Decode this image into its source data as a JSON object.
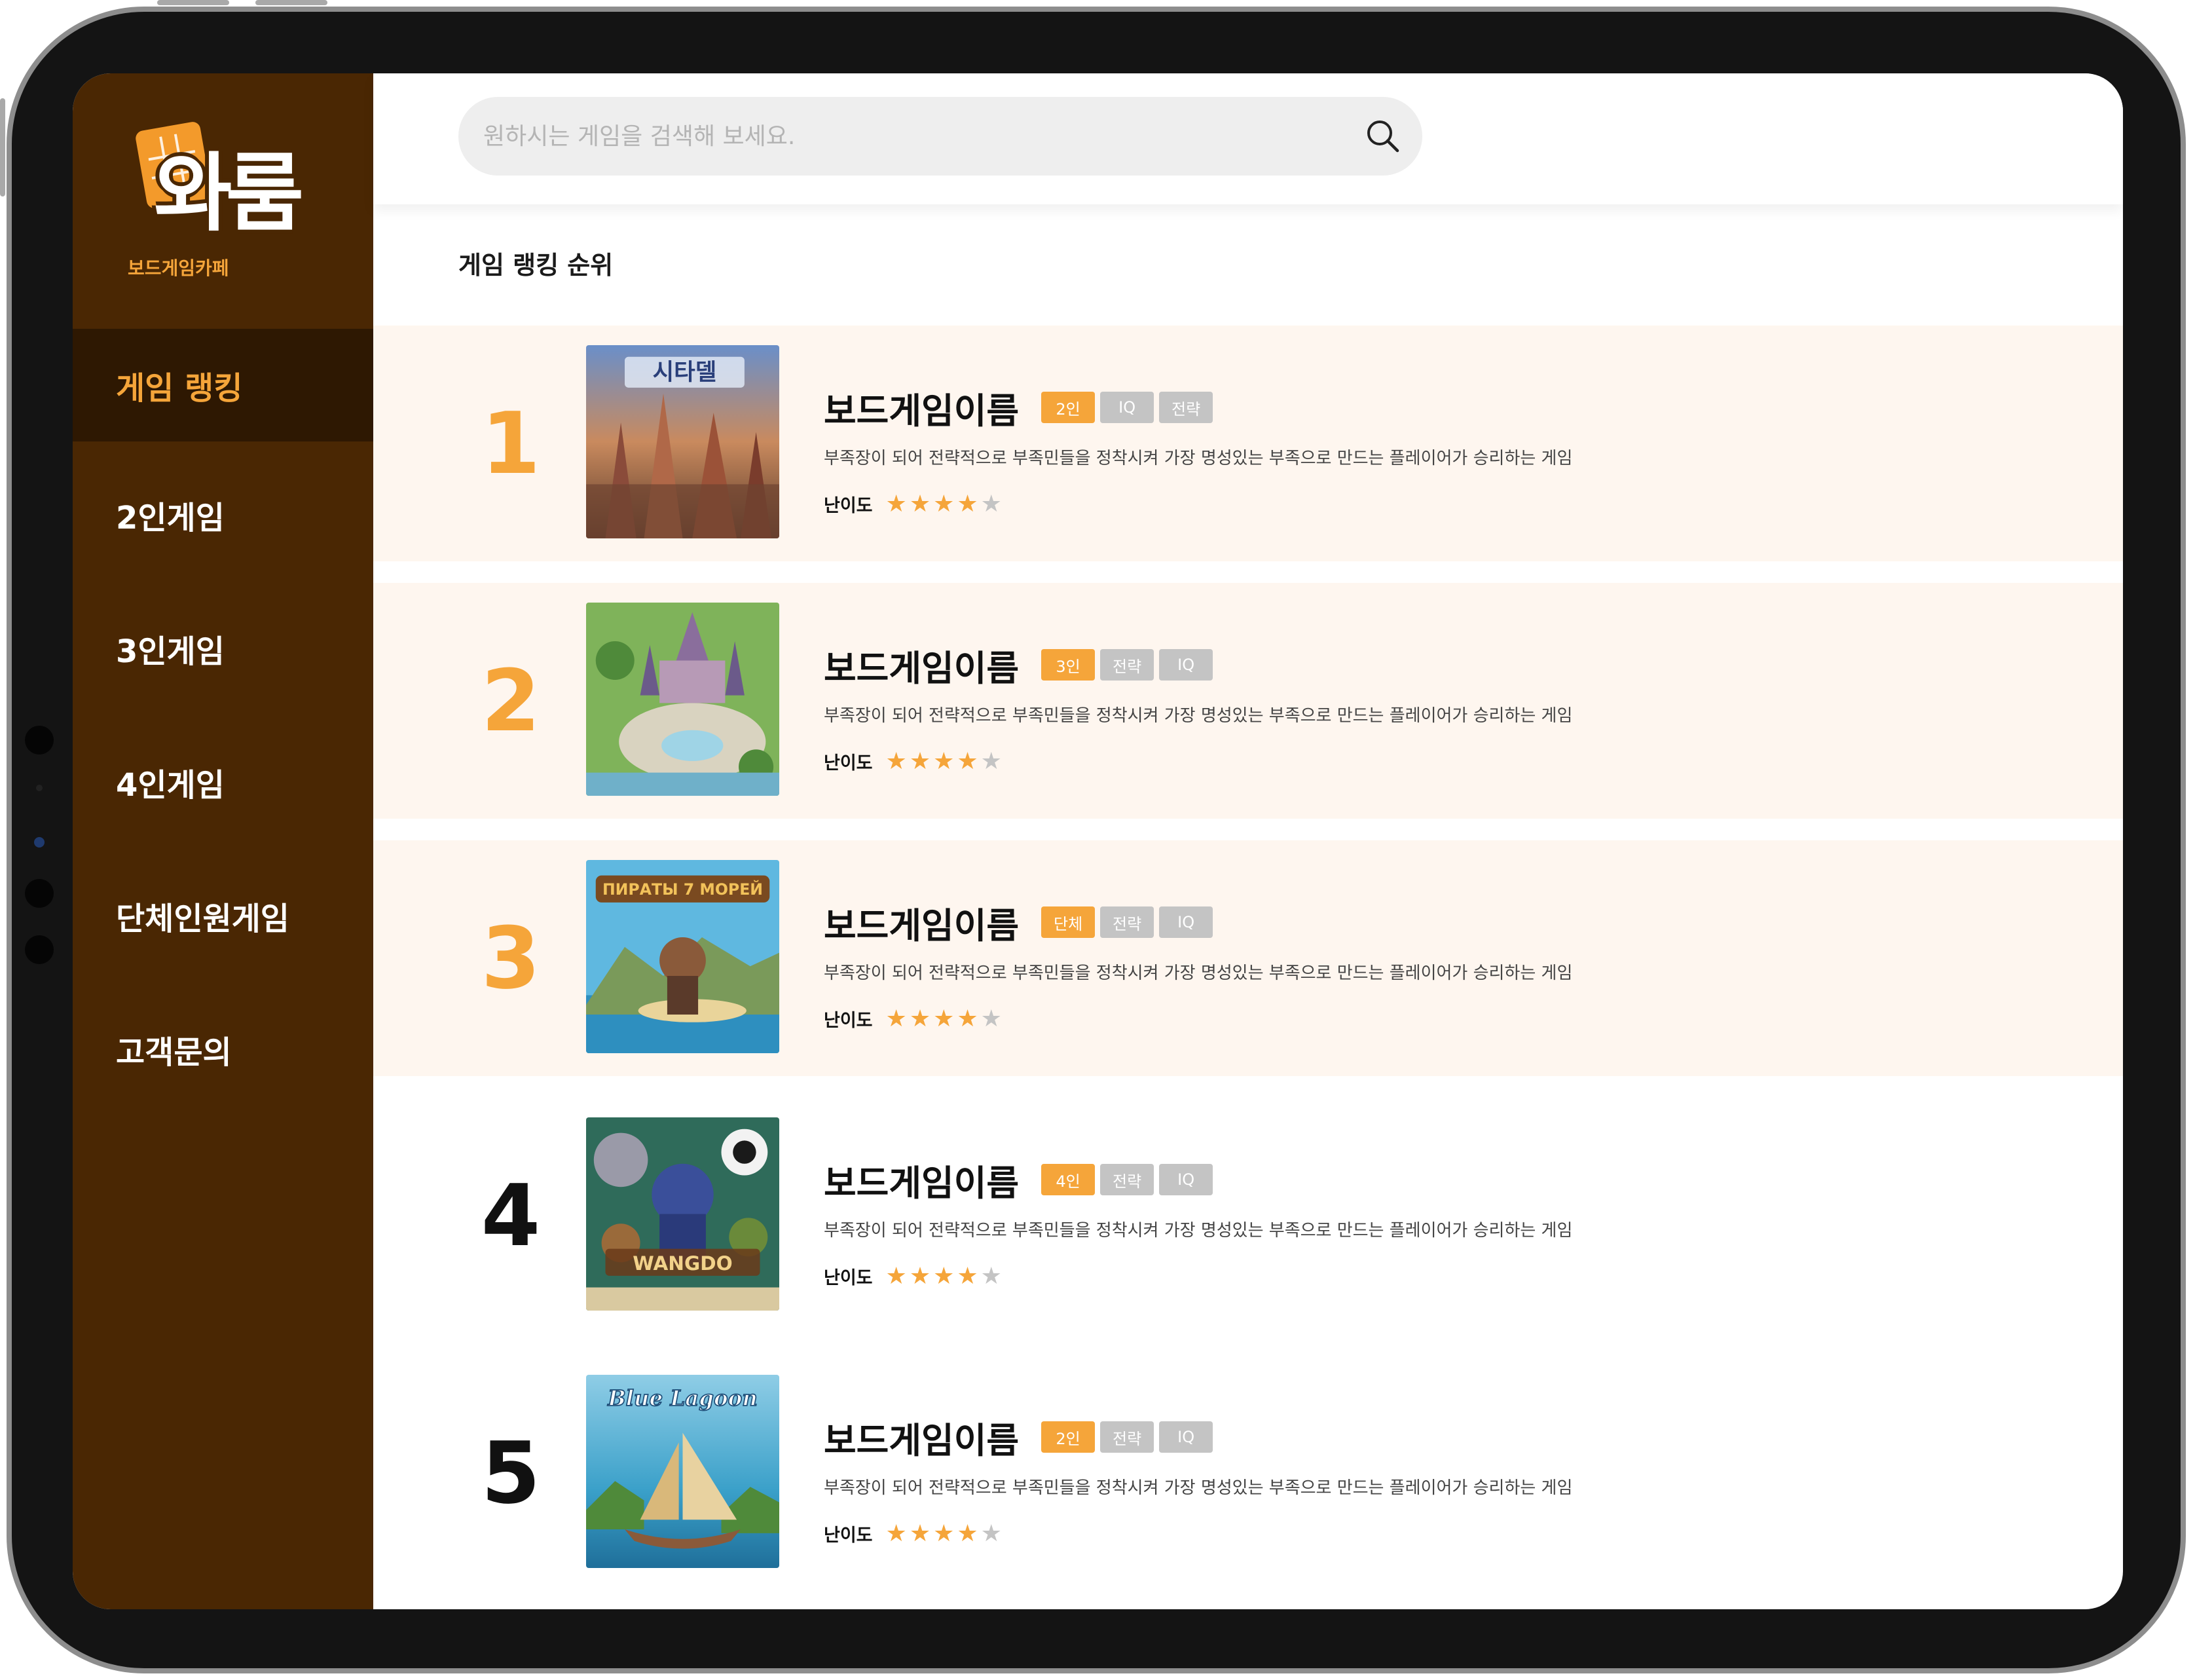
{
  "colors": {
    "sidebar_bg": "#4a2703",
    "sidebar_active_bg": "#2e1802",
    "accent": "#f5a53a",
    "tag_gray": "#c4c4c4",
    "row_highlight": "#fef6ef"
  },
  "logo": {
    "title": "와룸",
    "subtitle": "보드게임카페",
    "icon": "waffle-icon"
  },
  "sidebar": {
    "items": [
      {
        "label": "게임 랭킹",
        "active": true
      },
      {
        "label": "2인게임",
        "active": false
      },
      {
        "label": "3인게임",
        "active": false
      },
      {
        "label": "4인게임",
        "active": false
      },
      {
        "label": "단체인원게임",
        "active": false
      },
      {
        "label": "고객문의",
        "active": false
      }
    ]
  },
  "search": {
    "placeholder": "원하시는 게임을 검색해 보세요.",
    "value": "",
    "icon": "search-icon"
  },
  "section_title": "게임 랭킹 순위",
  "difficulty_label": "난이도",
  "games": [
    {
      "rank": "1",
      "name": "보드게임이름",
      "tags": [
        "2인",
        "IQ",
        "전략"
      ],
      "description": "부족장이 되어 전략적으로 부족민들을 정착시켜 가장 명성있는 부족으로 만드는 플레이어가 승리하는 게임",
      "difficulty": 4,
      "max_difficulty": 5,
      "cover_title": "시타델",
      "highlight": true,
      "rank_color": "#f5a53a"
    },
    {
      "rank": "2",
      "name": "보드게임이름",
      "tags": [
        "3인",
        "전략",
        "IQ"
      ],
      "description": "부족장이 되어 전략적으로 부족민들을 정착시켜 가장 명성있는 부족으로 만드는 플레이어가 승리하는 게임",
      "difficulty": 4,
      "max_difficulty": 5,
      "cover_title": "",
      "highlight": true,
      "rank_color": "#f5a53a"
    },
    {
      "rank": "3",
      "name": "보드게임이름",
      "tags": [
        "단체",
        "전략",
        "IQ"
      ],
      "description": "부족장이 되어 전략적으로 부족민들을 정착시켜 가장 명성있는 부족으로 만드는 플레이어가 승리하는 게임",
      "difficulty": 4,
      "max_difficulty": 5,
      "cover_title": "ПИРАТЫ 7 МОРЕЙ",
      "highlight": true,
      "rank_color": "#f5a53a"
    },
    {
      "rank": "4",
      "name": "보드게임이름",
      "tags": [
        "4인",
        "전략",
        "IQ"
      ],
      "description": "부족장이 되어 전략적으로 부족민들을 정착시켜 가장 명성있는 부족으로 만드는 플레이어가 승리하는 게임",
      "difficulty": 4,
      "max_difficulty": 5,
      "cover_title": "WANGDO",
      "highlight": false,
      "rank_color": "#111111"
    },
    {
      "rank": "5",
      "name": "보드게임이름",
      "tags": [
        "2인",
        "전략",
        "IQ"
      ],
      "description": "부족장이 되어 전략적으로 부족민들을 정착시켜 가장 명성있는 부족으로 만드는 플레이어가 승리하는 게임",
      "difficulty": 4,
      "max_difficulty": 5,
      "cover_title": "Blue Lagoon",
      "highlight": false,
      "rank_color": "#111111"
    }
  ]
}
